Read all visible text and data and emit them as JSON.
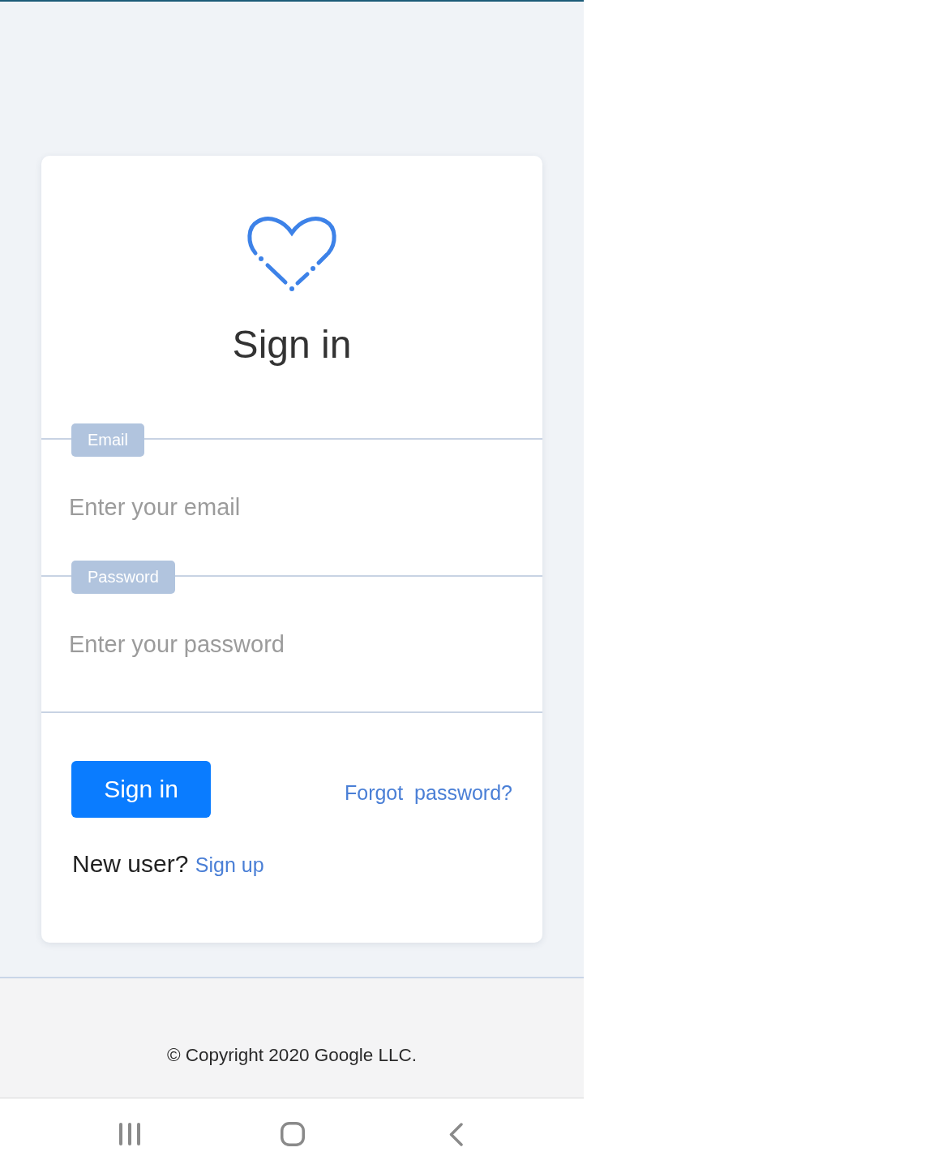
{
  "title": "Sign in",
  "fields": [
    {
      "label": "Email",
      "placeholder": "Enter your email"
    },
    {
      "label": "Password",
      "placeholder": "Enter your password"
    }
  ],
  "submit_button": "Sign in",
  "forgot_link": "Forgot  password?",
  "signup_prompt": {
    "text": "New user?",
    "link": "Sign up"
  },
  "footer": "© Copyright 2020 Google LLC."
}
